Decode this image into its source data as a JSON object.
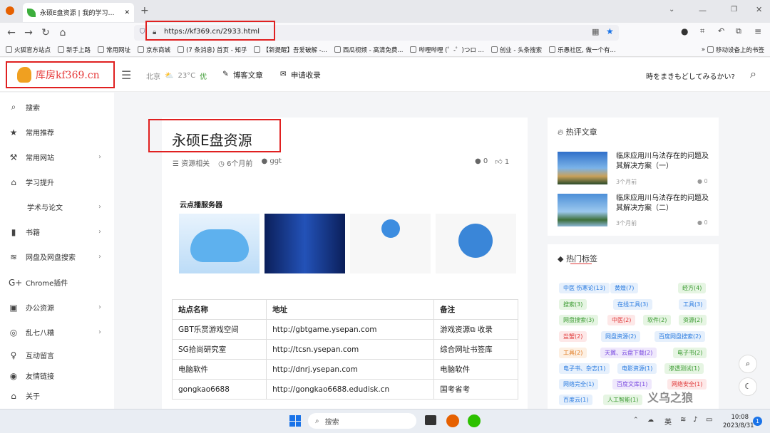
{
  "browser": {
    "tab_title": "永硕E盘资源 | 我的学习信息记录",
    "url": "https://kf369.cn/2933.html",
    "bookmarks": [
      "火狐官方站点",
      "新手上路",
      "常用网址",
      "京东商城",
      "(7 条消息) 首页 - 知乎",
      "【新提醒】吾爱破解 -...",
      "西瓜视频 - 高清免费...",
      "哔哩哔哩 (゜-゜)つロ ...",
      "创业 - 头条搜索",
      "乐愚社区, 做一个有...",
      "移动设备上的书签"
    ]
  },
  "header": {
    "logo_text": "库房kf369.cn",
    "weather_city": "北京",
    "weather_temp": "23°C",
    "weather_quality": "优",
    "nav_blog": "博客文章",
    "nav_apply": "申请收录",
    "slogan": "時をまきもどしてみるかい?"
  },
  "sidebar": {
    "items": [
      {
        "label": "搜索",
        "icon": "search-icon",
        "arrow": false
      },
      {
        "label": "常用推荐",
        "icon": "star-icon",
        "arrow": false
      },
      {
        "label": "常用网站",
        "icon": "tools-icon",
        "arrow": true
      },
      {
        "label": "学习提升",
        "icon": "bank-icon",
        "arrow": false
      },
      {
        "label": "学术与论文",
        "icon": "",
        "arrow": true
      },
      {
        "label": "书籍",
        "icon": "book-icon",
        "arrow": true
      },
      {
        "label": "网盘及网盘搜索",
        "icon": "wifi-icon",
        "arrow": true
      },
      {
        "label": "Chrome插件",
        "icon": "google-plus-icon",
        "arrow": false
      },
      {
        "label": "办公资源",
        "icon": "briefcase-icon",
        "arrow": true
      },
      {
        "label": "乱七八糟",
        "icon": "compass-icon",
        "arrow": true
      },
      {
        "label": "互动留言",
        "icon": "female-icon",
        "arrow": false
      },
      {
        "label": "友情链接",
        "icon": "wechat-icon",
        "arrow": false
      },
      {
        "label": "关于",
        "icon": "home-icon",
        "arrow": false
      }
    ]
  },
  "article": {
    "title": "永硕E盘资源",
    "category": "资源相关",
    "time": "6个月前",
    "author": "ggt",
    "comments": "0",
    "likes": "1",
    "ad_label": "云点播服务器"
  },
  "table": {
    "headers": [
      "站点名称",
      "地址",
      "备注"
    ],
    "rows": [
      [
        "GBT乐赏游戏空间",
        "http://gbtgame.ysepan.com",
        "游戏资源⧉ 收录"
      ],
      [
        "SG拾尚研究室",
        "http://tcsn.ysepan.com",
        "综合网址书签库"
      ],
      [
        "电脑软件",
        "http://dnrj.ysepan.com",
        "电脑软件"
      ],
      [
        "gongkao6688",
        "http://gongkao6688.edudisk.cn",
        "国考省考"
      ]
    ]
  },
  "hot_articles": {
    "title": "热评文章",
    "items": [
      {
        "title": "临床应用川乌法存在的问题及其解决方案（一）",
        "time": "3个月前",
        "comments": "0"
      },
      {
        "title": "临床应用川乌法存在的问题及其解决方案（二）",
        "time": "3个月前",
        "comments": "0"
      }
    ]
  },
  "hot_tags": {
    "title": "热门标签",
    "tags": [
      {
        "text": "中医 伤寒论(13)",
        "color": "#2a7be0",
        "bg": "#e6f0fc"
      },
      {
        "text": "黄煌(7)",
        "color": "#2a7be0",
        "bg": "#e6f0fc"
      },
      {
        "text": "经方(4)",
        "color": "#3a9a30",
        "bg": "#e6f5e3"
      },
      {
        "text": "搜索(3)",
        "color": "#3a9a30",
        "bg": "#e6f5e3"
      },
      {
        "text": "在线工具(3)",
        "color": "#2a7be0",
        "bg": "#e6f0fc"
      },
      {
        "text": "工具(3)",
        "color": "#2a7be0",
        "bg": "#e6f0fc"
      },
      {
        "text": "网盘搜索(3)",
        "color": "#3a9a30",
        "bg": "#e6f5e3"
      },
      {
        "text": "中医(2)",
        "color": "#e03a3a",
        "bg": "#fde8e8"
      },
      {
        "text": "软件(2)",
        "color": "#3a9a30",
        "bg": "#e6f5e3"
      },
      {
        "text": "资源(2)",
        "color": "#3a9a30",
        "bg": "#e6f5e3"
      },
      {
        "text": "盐蟹(2)",
        "color": "#e03a3a",
        "bg": "#fde8e8"
      },
      {
        "text": "网盘资源(2)",
        "color": "#2a7be0",
        "bg": "#e6f0fc"
      },
      {
        "text": "百度网盘搜索(2)",
        "color": "#2a7be0",
        "bg": "#e6f0fc"
      },
      {
        "text": "工具(2)",
        "color": "#e07a20",
        "bg": "#fdf0e3"
      },
      {
        "text": "天翼、云盘下载(2)",
        "color": "#7a4ae0",
        "bg": "#efe8fc"
      },
      {
        "text": "电子书(2)",
        "color": "#3a9a30",
        "bg": "#e6f5e3"
      },
      {
        "text": "电子书、杂志(1)",
        "color": "#2a7be0",
        "bg": "#e6f0fc"
      },
      {
        "text": "电影资源(1)",
        "color": "#2a7be0",
        "bg": "#e6f0fc"
      },
      {
        "text": "渗透测试(1)",
        "color": "#3a9a30",
        "bg": "#e6f5e3"
      },
      {
        "text": "网络完全(1)",
        "color": "#2a7be0",
        "bg": "#e6f0fc"
      },
      {
        "text": "百度文库(1)",
        "color": "#7a4ae0",
        "bg": "#efe8fc"
      },
      {
        "text": "网络安全(1)",
        "color": "#e03a3a",
        "bg": "#fde8e8"
      },
      {
        "text": "百度云(1)",
        "color": "#2a7be0",
        "bg": "#e6f0fc"
      },
      {
        "text": "人工智能(1)",
        "color": "#3a9a30",
        "bg": "#e6f5e3"
      }
    ]
  },
  "taskbar": {
    "search_placeholder": "搜索",
    "lang": "英",
    "time": "10:08",
    "date": "2023/8/31",
    "notif": "1"
  },
  "watermark": "义乌之狼"
}
